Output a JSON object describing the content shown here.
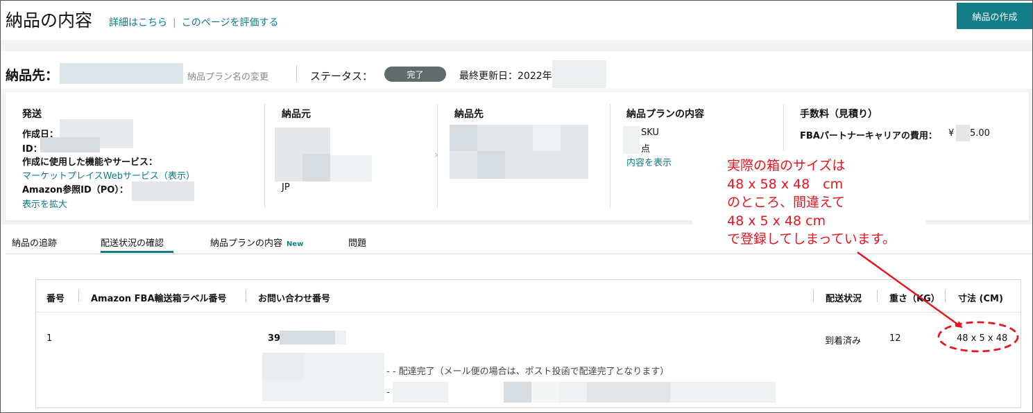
{
  "header": {
    "title": "納品の内容",
    "details_link": "詳細はこちら",
    "separator": "|",
    "rate_link": "このページを評価する",
    "create_button": "納品の作成"
  },
  "destination": {
    "label": "納品先：",
    "rename_link": "納品プラン名の変更",
    "status_label": "ステータス：",
    "status_value": "完了",
    "updated_label": "最終更新日：2022年"
  },
  "summary": {
    "shipping": {
      "title": "発送",
      "created_label": "作成日：",
      "id_label": "ID：",
      "feature_label": "作成に使用した機能やサービス：",
      "feature_link": "マーケットプレイスWebサービス（表示）",
      "po_label": "Amazon参照ID（PO）：",
      "expand_link": "表示を拡大"
    },
    "origin": {
      "title": "納品元",
      "country": "JP"
    },
    "destination": {
      "title": "納品先"
    },
    "plan": {
      "title": "納品プランの内容",
      "sku_label": "SKU",
      "units_label": "点",
      "view_link": "内容を表示"
    },
    "fees": {
      "title": "手数料（見積り）",
      "carrier_label": "FBAパートナーキャリアの費用：",
      "carrier_value_prefix": "¥",
      "carrier_value_suffix": "5.00"
    }
  },
  "annotation": {
    "text": "実際の箱のサイズは\n48 x 58 x 48　cm\nのところ、間違えて\n48 x 5 x 48 cm\nで登録してしまっています。",
    "color": "#e8141e"
  },
  "tabs": [
    {
      "label": "納品の追跡"
    },
    {
      "label": "配送状況の確認",
      "active": true
    },
    {
      "label": "納品プランの内容",
      "badge": "New"
    },
    {
      "label": "問題"
    }
  ],
  "table": {
    "columns": [
      "番号",
      "Amazon FBA輸送箱ラベル番号",
      "お問い合わせ番号",
      "配送状況",
      "重さ（KG）",
      "寸法 (CM)"
    ],
    "rows": [
      {
        "number": "1",
        "tracking_prefix": "39",
        "status": "到着済み",
        "weight": "12",
        "dimensions": "48 x 5 x 48",
        "event_1": "- - 配達完了（メール便の場合は、ポスト投函で配達完了となります）",
        "event_2": "-"
      }
    ]
  },
  "colors": {
    "accent": "#127d87",
    "link": "#0a7b8a",
    "badge": "#5f6b6c",
    "annotation": "#e8141e"
  }
}
